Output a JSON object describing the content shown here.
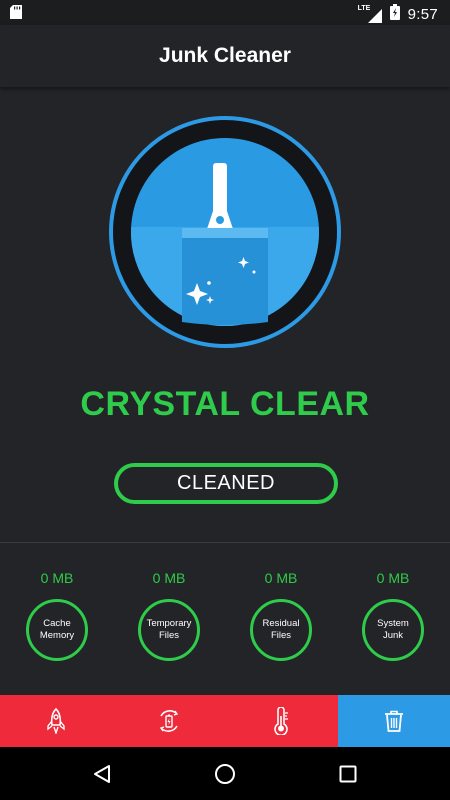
{
  "status_bar": {
    "network": "LTE",
    "time": "9:57",
    "icons": [
      "sd-card-icon",
      "signal-icon",
      "battery-icon"
    ]
  },
  "app_bar": {
    "title": "Junk Cleaner"
  },
  "hero": {
    "icon": "broom-icon",
    "status_text": "CRYSTAL CLEAR",
    "button_label": "CLEANED"
  },
  "stats": [
    {
      "size": "0 MB",
      "label": "Cache Memory"
    },
    {
      "size": "0 MB",
      "label": "Temporary Files"
    },
    {
      "size": "0 MB",
      "label": "Residual Files"
    },
    {
      "size": "0 MB",
      "label": "System Junk"
    }
  ],
  "tabs": [
    {
      "icon": "rocket-icon"
    },
    {
      "icon": "battery-refresh-icon"
    },
    {
      "icon": "thermometer-icon"
    },
    {
      "icon": "trash-icon",
      "active": true
    }
  ],
  "nav": [
    "back-icon",
    "home-icon",
    "recents-icon"
  ],
  "colors": {
    "background": "#232427",
    "accent_green": "#2ecc4a",
    "accent_blue": "#2d9ae6",
    "tab_red": "#ee2a3b"
  }
}
